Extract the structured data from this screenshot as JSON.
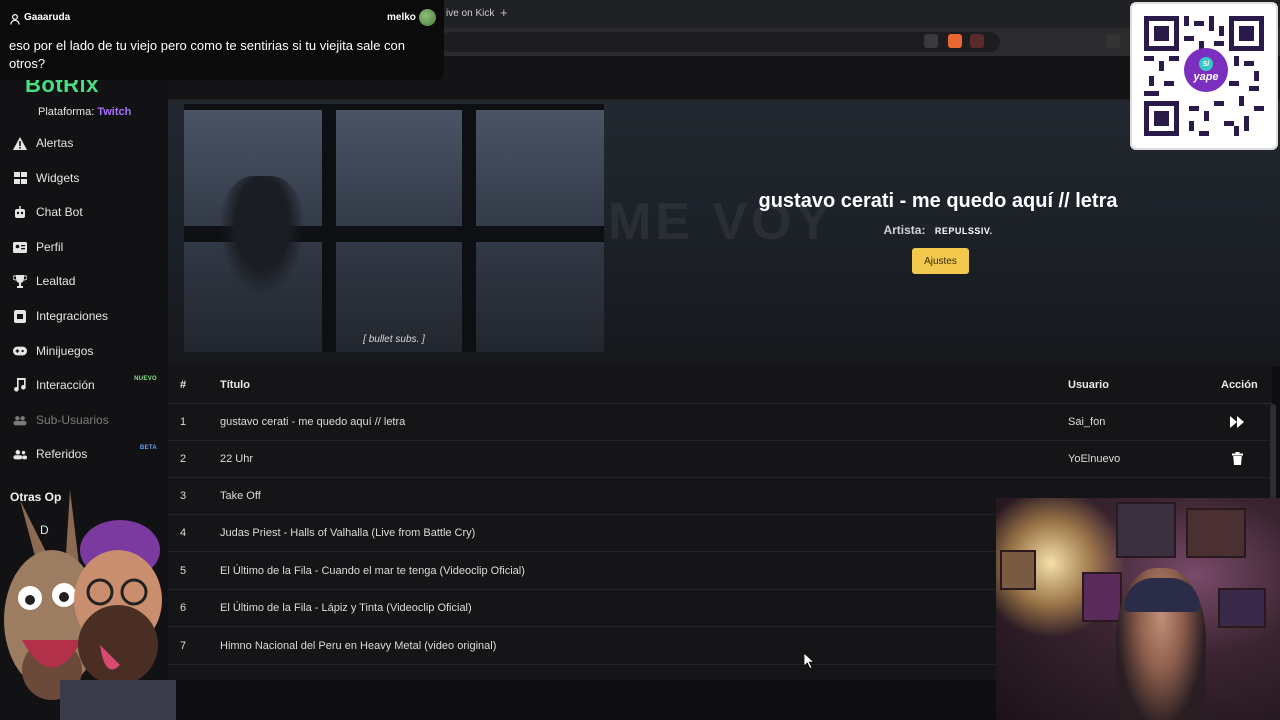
{
  "browser": {
    "tab_fragment": "ive on Kick",
    "new_tab": "+"
  },
  "chat_overlay": {
    "username": "Gaaaruda",
    "bot_name": "melko",
    "message": "eso por el lado de tu viejo pero como te sentirias si tu viejita sale con otros?"
  },
  "sidebar": {
    "logo": "BotRix",
    "platform_label": "Plataforma:",
    "platform_value": "Twitch",
    "items": [
      {
        "label": "Alertas",
        "icon": "warning-icon"
      },
      {
        "label": "Widgets",
        "icon": "grid-icon"
      },
      {
        "label": "Chat Bot",
        "icon": "robot-icon"
      },
      {
        "label": "Perfil",
        "icon": "id-card-icon"
      },
      {
        "label": "Lealtad",
        "icon": "trophy-icon"
      },
      {
        "label": "Integraciones",
        "icon": "plug-icon"
      },
      {
        "label": "Minijuegos",
        "icon": "gamepad-icon"
      },
      {
        "label": "Interacción",
        "icon": "music-icon",
        "badge": "NUEVO"
      },
      {
        "label": "Sub-Usuarios",
        "icon": "users-icon"
      },
      {
        "label": "Referidos",
        "icon": "user-group-icon",
        "badge": "BETA"
      }
    ],
    "section_title": "Otras Op",
    "section_fragment": "D"
  },
  "now_playing": {
    "title": "gustavo cerati - me quedo aquí // letra",
    "artist_label": "Artista:",
    "artist": "REPULSSIV.",
    "settings_button": "Ajustes",
    "thumbnail_caption": "[ bullet subs. ]"
  },
  "queue": {
    "columns": {
      "index": "#",
      "title": "Título",
      "user": "Usuario",
      "action": "Acción"
    },
    "rows": [
      {
        "index": "1",
        "title": "gustavo cerati - me quedo aquí // letra",
        "user": "Sai_fon",
        "action": "skip-icon"
      },
      {
        "index": "2",
        "title": "22 Uhr",
        "user": "YoElnuevo",
        "action": "trash-icon"
      },
      {
        "index": "3",
        "title": "Take Off",
        "user": "",
        "action": ""
      },
      {
        "index": "4",
        "title": "Judas Priest - Halls of Valhalla (Live from Battle Cry)",
        "user": "",
        "action": ""
      },
      {
        "index": "5",
        "title": "El Último de la Fila - Cuando el mar te tenga (Videoclip Oficial)",
        "user": "",
        "action": ""
      },
      {
        "index": "6",
        "title": "El Último de la Fila - Lápiz y Tinta (Videoclip Oficial)",
        "user": "",
        "action": ""
      },
      {
        "index": "7",
        "title": "Himno Nacional del Peru en Heavy Metal (video original)",
        "user": "",
        "action": ""
      }
    ]
  },
  "qr": {
    "brand": "yape",
    "badge": "S/"
  },
  "colors": {
    "accent_green": "#4ade80",
    "twitch_purple": "#a970ff",
    "button_yellow": "#f2c94c",
    "badge_new": "#7ee787",
    "badge_beta": "#5ea2ff"
  }
}
